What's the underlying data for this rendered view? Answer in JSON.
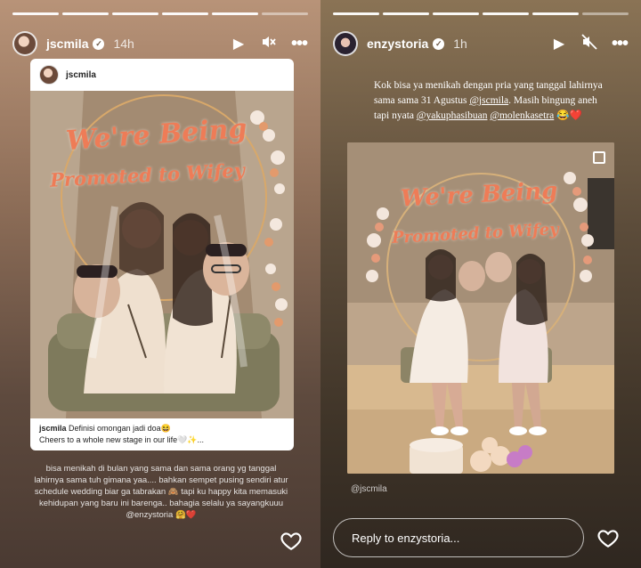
{
  "left_story": {
    "progress_segments": 6,
    "username": "jscmila",
    "time": "14h",
    "card": {
      "username": "jscmila",
      "neon_line1": "We're Being",
      "neon_line2": "Promoted to Wifey",
      "caption_user": "jscmila",
      "caption_line1": "Definisi omongan jadi doa😆",
      "caption_line2": "Cheers to a whole new stage in our life🤍✨..."
    },
    "caption": "bisa menikah di bulan yang sama dan sama orang yg tanggal lahirnya sama tuh gimana yaa.... bahkan sempet pusing sendiri atur schedule wedding biar ga tabrakan 🙈 tapi ku happy kita memasuki kehidupan yang baru ini barenga.. bahagia selalu ya sayangkuuu @enzystoria 🤗❤️"
  },
  "right_story": {
    "progress_segments": 6,
    "username": "enzystoria",
    "time": "1h",
    "text_part1": "Kok bisa ya menikah dengan pria yang tanggal lahirnya sama sama 31 Agustus ",
    "mention1": "@jscmila",
    "text_part2": ". Masih bingung aneh tapi nyata ",
    "mention2": "@yakuphasibuan",
    "text_part3": " ",
    "mention3": "@molenkasetra",
    "text_part4": " 😂❤️",
    "neon_line1": "We're Being",
    "neon_line2": "Promoted to Wifey",
    "photo_tag": "@jscmila",
    "reply_placeholder": "Reply to enzystoria..."
  },
  "icons": {
    "play": "play-icon",
    "mute": "mute-icon",
    "more": "more-icon",
    "heart": "heart-icon",
    "verified": "verified-badge-icon"
  }
}
